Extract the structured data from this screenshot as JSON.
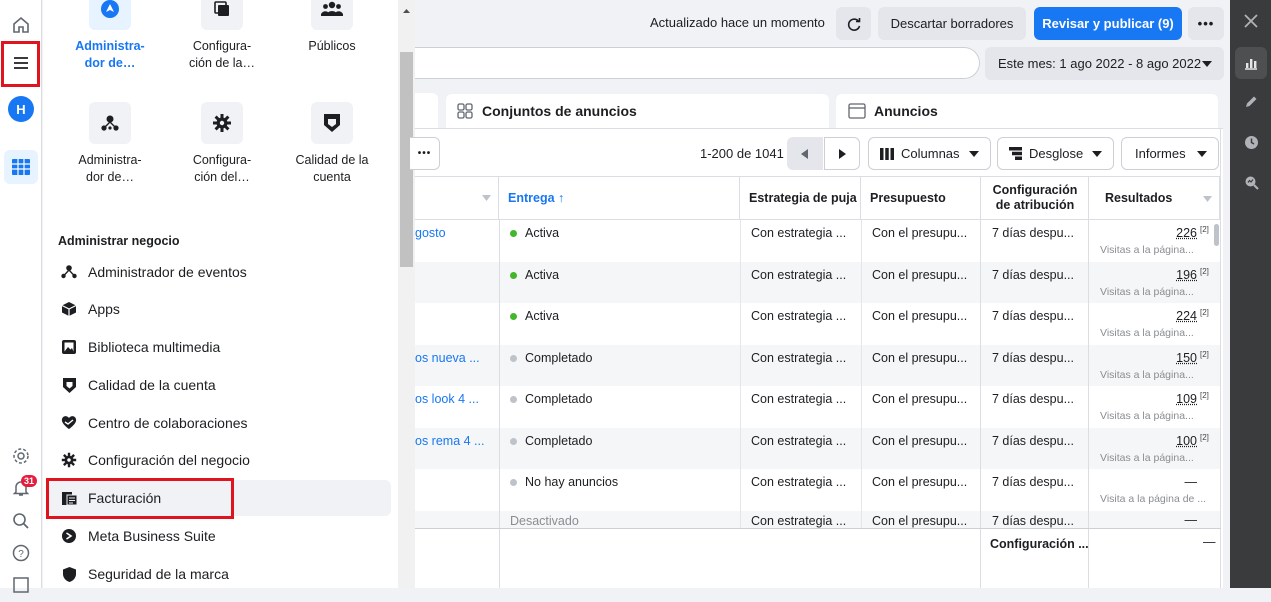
{
  "rail": {
    "avatar_letter": "H",
    "notification_count": "31"
  },
  "drawer": {
    "top_tiles": [
      {
        "label": "Administra-\ndor de…",
        "icon": "nav-arrow-icon"
      },
      {
        "label": "Configura-\nción de la…",
        "icon": "copy-icon"
      },
      {
        "label": "Públicos",
        "icon": "people-icon"
      }
    ],
    "tiles": [
      {
        "label": "Administra-\ndor de…",
        "icon": "events-icon"
      },
      {
        "label": "Configura-\nción del…",
        "icon": "gear-icon"
      },
      {
        "label": "Calidad de la\ncuenta",
        "icon": "shield-icon"
      }
    ],
    "section_title": "Administrar negocio",
    "menu": [
      {
        "label": "Administrador de eventos",
        "icon": "events-icon"
      },
      {
        "label": "Apps",
        "icon": "cube-icon"
      },
      {
        "label": "Biblioteca multimedia",
        "icon": "image-icon"
      },
      {
        "label": "Calidad de la cuenta",
        "icon": "shield-icon"
      },
      {
        "label": "Centro de colaboraciones",
        "icon": "handshake-icon"
      },
      {
        "label": "Configuración del negocio",
        "icon": "gear-icon"
      },
      {
        "label": "Facturación",
        "icon": "billing-icon"
      },
      {
        "label": "Meta Business Suite",
        "icon": "meta-icon"
      },
      {
        "label": "Seguridad de la marca",
        "icon": "shield-check-icon"
      }
    ]
  },
  "toolbar": {
    "status": "Actualizado hace un momento",
    "discard": "Descartar borradores",
    "publish": "Revisar y publicar (9)",
    "date_range": "Este mes: 1 ago 2022 - 8 ago 2022"
  },
  "tabs": [
    {
      "label": "Conjuntos de anuncios",
      "icon": "grid-icon"
    },
    {
      "label": "Anuncios",
      "icon": "window-icon"
    }
  ],
  "table_toolbar": {
    "pagination": "1-200 de 1041",
    "columns": "Columnas",
    "breakdown": "Desglose",
    "reports": "Informes"
  },
  "table": {
    "headers": [
      "Entrega ↑",
      "Estrategia de puja",
      "Presupuesto",
      "Configuración\nde atribución",
      "Resultados"
    ],
    "rows": [
      {
        "name": "gosto",
        "delivery": "Activa",
        "status": "active",
        "bid": "Con estrategia ...",
        "budget": "Con el presupu...",
        "attribution": "7 días despu...",
        "result": "226",
        "result_sub": "Visitas a la página..."
      },
      {
        "name": "",
        "delivery": "Activa",
        "status": "active",
        "bid": "Con estrategia ...",
        "budget": "Con el presupu...",
        "attribution": "7 días despu...",
        "result": "196",
        "result_sub": "Visitas a la página..."
      },
      {
        "name": "",
        "delivery": "Activa",
        "status": "active",
        "bid": "Con estrategia ...",
        "budget": "Con el presupu...",
        "attribution": "7 días despu...",
        "result": "224",
        "result_sub": "Visitas a la página..."
      },
      {
        "name": "os nueva ...",
        "delivery": "Completado",
        "status": "done",
        "bid": "Con estrategia ...",
        "budget": "Con el presupu...",
        "attribution": "7 días despu...",
        "result": "150",
        "result_sub": "Visitas a la página..."
      },
      {
        "name": "os look 4 ...",
        "delivery": "Completado",
        "status": "done",
        "bid": "Con estrategia ...",
        "budget": "Con el presupu...",
        "attribution": "7 días despu...",
        "result": "109",
        "result_sub": "Visitas a la página..."
      },
      {
        "name": "os rema 4 ...",
        "delivery": "Completado",
        "status": "done",
        "bid": "Con estrategia ...",
        "budget": "Con el presupu...",
        "attribution": "7 días despu...",
        "result": "100",
        "result_sub": "Visitas a la página..."
      },
      {
        "name": "",
        "delivery": "No hay anuncios",
        "status": "none",
        "bid": "Con estrategia ...",
        "budget": "Con el presupu...",
        "attribution": "7 días despu...",
        "result": "—",
        "result_sub": "Visita a la página de ..."
      },
      {
        "name": "",
        "delivery": "Desactivado",
        "status": "off",
        "bid": "Con estrategia ...",
        "budget": "Con el presupu...",
        "attribution": "7 días despu...",
        "result": "—",
        "result_sub": ""
      }
    ],
    "footer_attribution": "Configuración ...",
    "footer_result": "—",
    "sup_mark": "[2]"
  },
  "colors": {
    "accent": "#1877f2",
    "active_dot": "#42b72a",
    "done_dot": "#bec3c9",
    "highlight_box": "#e0141e"
  }
}
